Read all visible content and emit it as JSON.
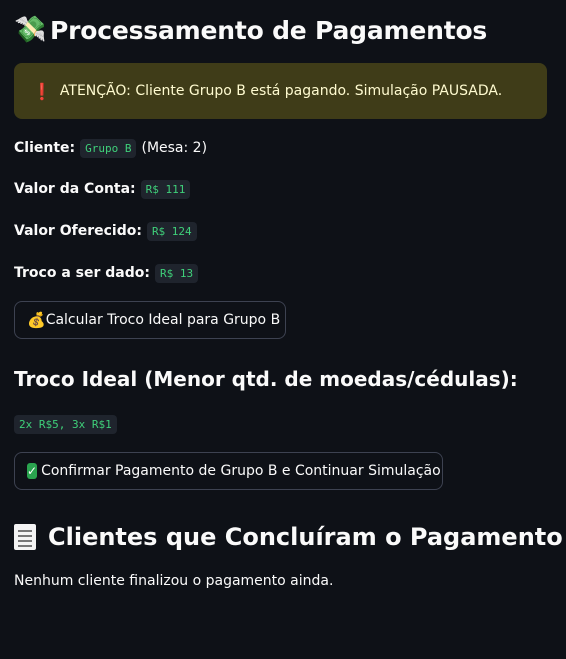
{
  "header": {
    "icon": "money-with-wings-emoji",
    "icon_glyph": "💸",
    "title": "Processamento de Pagamentos"
  },
  "alert": {
    "icon": "exclamation-icon",
    "icon_glyph": "❗",
    "text": "ATENÇÃO: Cliente Grupo B está pagando. Simulação PAUSADA.",
    "background": "#3f3c18",
    "text_color": "#fffbd0"
  },
  "details": {
    "client_label": "Cliente:",
    "client_value": "Grupo B",
    "table_info": "(Mesa: 2)",
    "bill_label": "Valor da Conta:",
    "bill_value": "R$ 111",
    "offered_label": "Valor Oferecido:",
    "offered_value": "R$ 124",
    "change_label": "Troco a ser dado:",
    "change_value": "R$ 13"
  },
  "calc_button": {
    "icon": "money-bag-icon",
    "icon_glyph": "💰",
    "label": "Calcular Troco Ideal para Grupo B"
  },
  "ideal_change": {
    "heading": "Troco Ideal (Menor qtd. de moedas/cédulas):",
    "value": "2x R$5, 3x R$1"
  },
  "confirm_button": {
    "icon": "check-mark-icon",
    "icon_glyph": "✓",
    "label": "Confirmar Pagamento de Grupo B e Continuar Simulação"
  },
  "completed": {
    "icon": "receipt-icon",
    "heading": "Clientes que Concluíram o Pagamento",
    "empty_text": "Nenhum cliente finalizou o pagamento ainda."
  },
  "colors": {
    "background": "#0e1117",
    "code_text": "#3fd07a",
    "code_background": "#1f242d",
    "button_border": "#3d4251"
  }
}
